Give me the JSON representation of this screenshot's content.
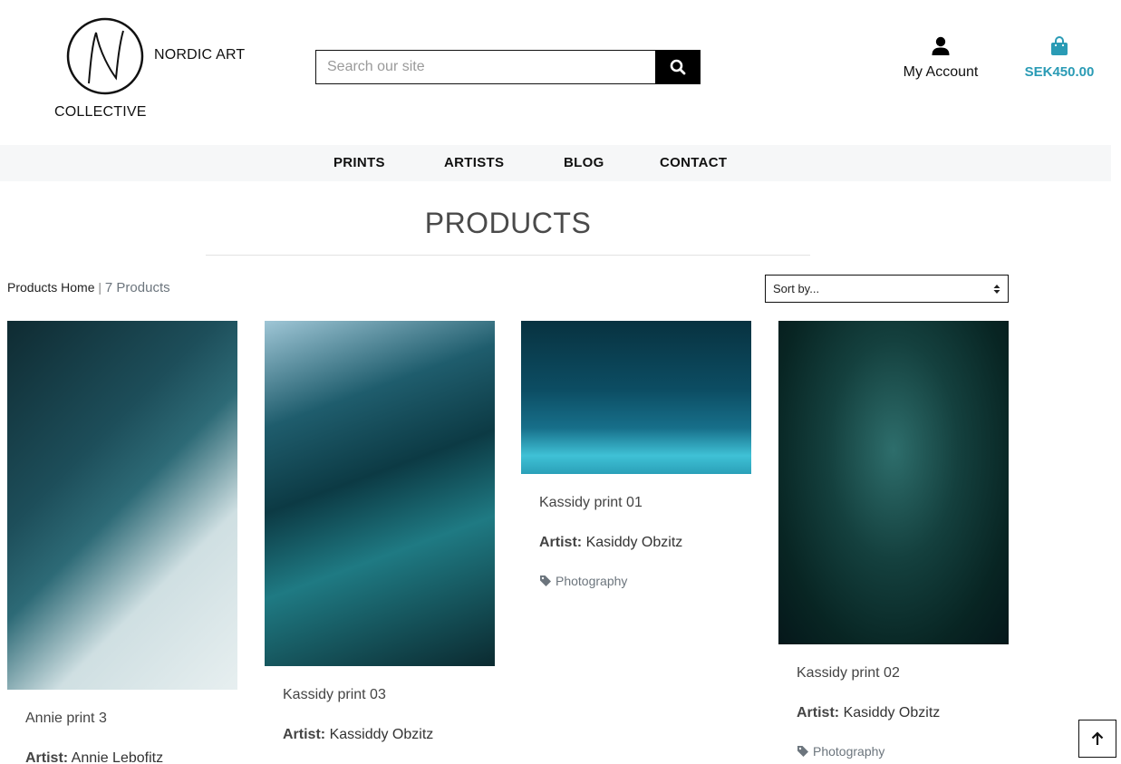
{
  "brand": {
    "name_top": "NORDIC ART",
    "name_bottom": "COLLECTIVE",
    "logo_icon": "n-signature-logo"
  },
  "search": {
    "placeholder": "Search our site",
    "value": "",
    "icon": "search-icon"
  },
  "account": {
    "label": "My Account",
    "icon": "user-icon"
  },
  "cart": {
    "label": "SEK450.00",
    "icon": "shopping-bag-icon",
    "color": "#2a9bb5"
  },
  "nav": {
    "items": [
      {
        "label": "PRINTS"
      },
      {
        "label": "ARTISTS"
      },
      {
        "label": "BLOG"
      },
      {
        "label": "CONTACT"
      }
    ]
  },
  "page": {
    "title": "PRODUCTS",
    "breadcrumb_home": "Products Home",
    "breadcrumb_sep": "|",
    "product_count": "7 Products",
    "sort_value": "Sort by..."
  },
  "products": [
    {
      "name": "Annie print 3",
      "artist_label": "Artist:",
      "artist": "Annie Lebofitz"
    },
    {
      "name": "Kassidy print 03",
      "artist_label": "Artist:",
      "artist": "Kassiddy Obzitz"
    },
    {
      "name": "Kassidy print 01",
      "artist_label": "Artist:",
      "artist": "Kasiddy Obzitz",
      "tag": "Photography"
    },
    {
      "name": "Kassidy print 02",
      "artist_label": "Artist:",
      "artist": "Kasiddy Obzitz",
      "tag": "Photography"
    }
  ],
  "back_to_top": {
    "icon": "arrow-up-icon"
  }
}
